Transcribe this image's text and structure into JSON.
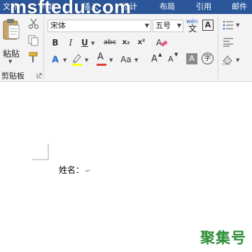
{
  "watermark": "msftedu.com",
  "tabs": [
    "文件",
    "开始",
    "插入",
    "设计",
    "布局",
    "引用",
    "邮件"
  ],
  "clipboard": {
    "paste_label": "粘贴",
    "group_label": "剪贴板"
  },
  "font": {
    "name": "宋体",
    "size": "五号",
    "pinyin_top": "wén",
    "bold": "B",
    "italic": "I",
    "underline": "U",
    "strikethrough": "abc",
    "subscript": "x₂",
    "superscript": "x²",
    "text_effects": "A",
    "highlight": "ab",
    "font_color": "A",
    "change_case": "Aa",
    "grow": "A",
    "shrink": "A",
    "char_border": "A",
    "char_shading": "A",
    "enclose": "字"
  },
  "colors": {
    "title_bar": "#2b579a",
    "highlight": "#ffff00",
    "font_color": "#e03c31",
    "brand": "#2f8f3a"
  },
  "document": {
    "line1": "姓名：",
    "paragraph_mark": "↵"
  },
  "brand": "聚集号"
}
